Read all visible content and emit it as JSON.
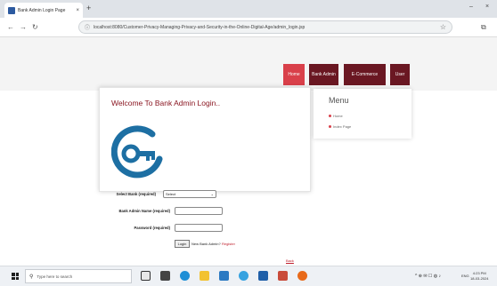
{
  "browser": {
    "tab_title": "Bank Admin Login Page",
    "tab_close": "×",
    "new_tab": "+",
    "minimize": "–",
    "close_window": "×",
    "back": "←",
    "forward": "→",
    "reload": "↻",
    "url": "localhost:8080/Customer-Privacy-Managing-Privacy-and-Security-in-the-Online-Digital-Age/admin_login.jsp",
    "bookmark_star": "☆",
    "ext_icon": "⧉"
  },
  "nav": {
    "items": [
      "Home",
      "Bank Admin",
      "E-Commerce",
      "User"
    ],
    "active": "Home"
  },
  "login_panel": {
    "heading": "Welcome To Bank Admin Login.."
  },
  "sidebar": {
    "title": "Menu",
    "items": [
      "Home",
      "Index Page"
    ]
  },
  "form": {
    "select_bank_label": "Select Bank (required)",
    "select_bank_value": "Select",
    "admin_name_label": "Bank Admin Name (required)",
    "password_label": "Password (required)",
    "login_button": "Login",
    "new_admin_text": "New Bank Admin?",
    "register_link": "Register",
    "back_link": "Back"
  },
  "taskbar": {
    "search_placeholder": "Type here to search",
    "tray_icons": "^ ⊕ ✉ ☐ ◍ ♪",
    "language": "ENG",
    "time": "4:23 PM",
    "date": "18-03-2024"
  },
  "colors": {
    "brand_dark": "#6a1722",
    "brand_active": "#d9404a",
    "heading": "#8a1621",
    "key_logo": "#1d6fa3"
  }
}
